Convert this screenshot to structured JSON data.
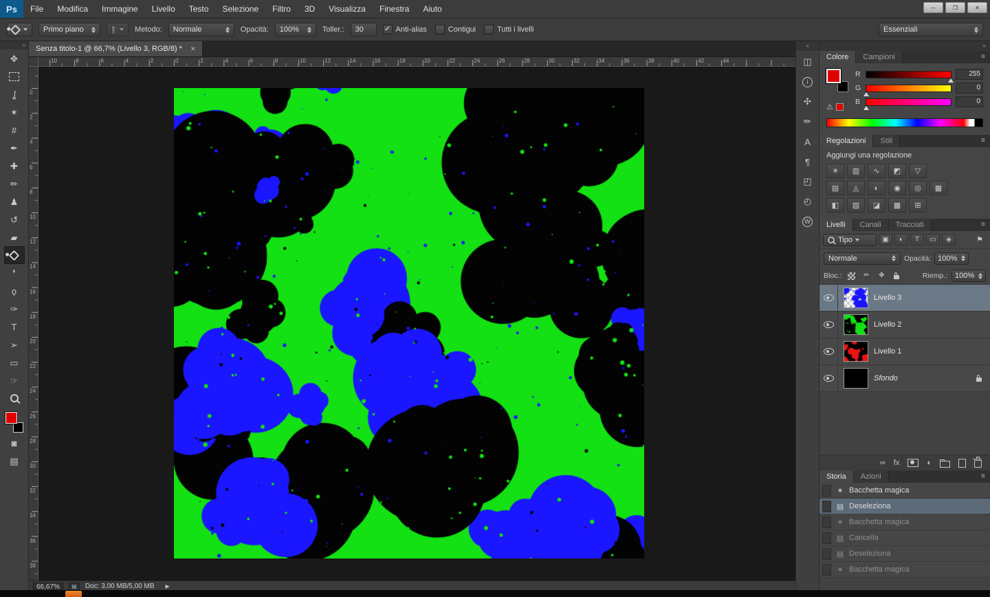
{
  "menubar": {
    "logo": "Ps",
    "items": [
      "File",
      "Modifica",
      "Immagine",
      "Livello",
      "Testo",
      "Selezione",
      "Filtro",
      "3D",
      "Visualizza",
      "Finestra",
      "Aiuto"
    ]
  },
  "window_controls": {
    "minimize": "─",
    "restore": "❐",
    "close": "✕"
  },
  "icons": {
    "collapse_right": "»",
    "collapse_left": "«",
    "panel_menu": "≡",
    "status_doc": "▤"
  },
  "options_bar": {
    "fill_source": "Primo piano",
    "method_label": "Metodo:",
    "method_value": "Normale",
    "opacity_label": "Opacità:",
    "opacity_value": "100%",
    "tolerance_label": "Toller.:",
    "tolerance_value": "30",
    "checkboxes": [
      {
        "label": "Anti-alias",
        "checked": true
      },
      {
        "label": "Contigui",
        "checked": false
      },
      {
        "label": "Tutti i livelli",
        "checked": false
      }
    ],
    "workspace": "Essenziali"
  },
  "toolbar": {
    "tools": [
      {
        "name": "move-tool",
        "glyph": "✥"
      },
      {
        "name": "rectangular-marquee-tool",
        "css": "marquee"
      },
      {
        "name": "lasso-tool",
        "glyph": "ʆ"
      },
      {
        "name": "magic-wand-tool",
        "glyph": "✶"
      },
      {
        "name": "crop-tool",
        "glyph": "#"
      },
      {
        "name": "eyedropper-tool",
        "glyph": "✒"
      },
      {
        "name": "healing-brush-tool",
        "glyph": "✚"
      },
      {
        "name": "brush-tool",
        "glyph": "✏"
      },
      {
        "name": "clone-stamp-tool",
        "glyph": "♟"
      },
      {
        "name": "history-brush-tool",
        "glyph": "↺"
      },
      {
        "name": "eraser-tool",
        "glyph": "▰"
      },
      {
        "name": "paint-bucket-tool",
        "css": "bucket",
        "selected": true
      },
      {
        "name": "blur-tool",
        "glyph": "❜"
      },
      {
        "name": "dodge-tool",
        "glyph": "ϙ"
      },
      {
        "name": "pen-tool",
        "glyph": "✑"
      },
      {
        "name": "type-tool",
        "glyph": "T"
      },
      {
        "name": "path-selection-tool",
        "glyph": "➢"
      },
      {
        "name": "rectangle-tool",
        "glyph": "▭"
      },
      {
        "name": "hand-tool",
        "glyph": "☞"
      },
      {
        "name": "zoom-tool",
        "css": "mag"
      }
    ],
    "extras": [
      {
        "name": "quick-mask-mode-button",
        "glyph": "◙"
      },
      {
        "name": "screen-mode-button",
        "glyph": "▤"
      }
    ]
  },
  "document": {
    "tab_title": "Senza titolo-1 @ 66,7% (Livello 3, RGB/8) *",
    "close_icon": "✕"
  },
  "rulers": {
    "h_labels": [
      "10",
      "8",
      "6",
      "4",
      "2",
      "0",
      "2",
      "4",
      "6",
      "8",
      "10",
      "12",
      "14",
      "16",
      "18",
      "20",
      "22",
      "24",
      "26",
      "28",
      "30",
      "32",
      "34",
      "36",
      "38",
      "40",
      "42",
      "44"
    ],
    "v_labels": [
      "0",
      "2",
      "4",
      "6",
      "8",
      "10",
      "12",
      "14",
      "16",
      "18",
      "20",
      "22",
      "24",
      "26",
      "28",
      "30",
      "32",
      "34",
      "36",
      "38"
    ]
  },
  "canvas_colors": {
    "background": "#13e113",
    "blue": "#1a16ff",
    "black": "#030303",
    "red": "#e81515"
  },
  "status_bar": {
    "zoom": "66,67%",
    "doc": "Doc: 3,00 MB/5,00 MB",
    "arrow": "▶"
  },
  "panel_icons": [
    {
      "name": "histogram-panel-icon",
      "glyph": "◫"
    },
    {
      "name": "info-panel-icon",
      "circ": "i"
    },
    {
      "name": "tool-presets-panel-icon",
      "glyph": "✣"
    },
    {
      "name": "brush-presets-panel-icon",
      "glyph": "✏"
    },
    {
      "name": "character-panel-icon",
      "glyph": "A"
    },
    {
      "name": "paragraph-panel-icon",
      "glyph": "¶"
    },
    {
      "name": "layer-comps-panel-icon",
      "glyph": "◰"
    },
    {
      "name": "timeline-panel-icon",
      "glyph": "◴"
    },
    {
      "name": "wacom-panel-icon",
      "circ": "W"
    }
  ],
  "color": {
    "tabs": [
      "Colore",
      "Campioni"
    ],
    "warning": "⚠",
    "channels": [
      {
        "label": "R",
        "value": "255",
        "grad": [
          "#000000",
          "#ff0000"
        ]
      },
      {
        "label": "G",
        "value": "0",
        "grad": [
          "#ff0000",
          "#ffff00"
        ]
      },
      {
        "label": "B",
        "value": "0",
        "grad": [
          "#ff0000",
          "#ff00ff"
        ]
      }
    ]
  },
  "adjustments": {
    "tabs": [
      "Regolazioni",
      "Stili"
    ],
    "title": "Aggiungi una regolazione",
    "rows": [
      [
        {
          "name": "brightness-contrast-icon",
          "glyph": "☀"
        },
        {
          "name": "levels-icon",
          "glyph": "▥"
        },
        {
          "name": "curves-icon",
          "glyph": "∿"
        },
        {
          "name": "exposure-icon",
          "glyph": "◩"
        },
        {
          "name": "vibrance-icon",
          "glyph": "▽"
        }
      ],
      [
        {
          "name": "hue-saturation-icon",
          "glyph": "▤"
        },
        {
          "name": "color-balance-icon",
          "glyph": "◬"
        },
        {
          "name": "black-white-icon",
          "glyph": "◐"
        },
        {
          "name": "photo-filter-icon",
          "glyph": "◉"
        },
        {
          "name": "channel-mixer-icon",
          "glyph": "◎"
        },
        {
          "name": "color-lookup-icon",
          "glyph": "▦"
        }
      ],
      [
        {
          "name": "invert-icon",
          "glyph": "◧"
        },
        {
          "name": "posterize-icon",
          "glyph": "▨"
        },
        {
          "name": "threshold-icon",
          "glyph": "◪"
        },
        {
          "name": "gradient-map-icon",
          "glyph": "▩"
        },
        {
          "name": "selective-color-icon",
          "glyph": "⊞"
        }
      ]
    ]
  },
  "layers": {
    "tabs": [
      "Livelli",
      "Canali",
      "Tracciati"
    ],
    "filter_label": "Tipo",
    "filter_icons": [
      {
        "name": "filter-pixel-layers-icon",
        "glyph": "▣"
      },
      {
        "name": "filter-adjustment-layers-icon",
        "glyph": "◐"
      },
      {
        "name": "filter-type-layers-icon",
        "glyph": "T"
      },
      {
        "name": "filter-shape-layers-icon",
        "glyph": "▭"
      },
      {
        "name": "filter-smart-objects-icon",
        "glyph": "◈"
      }
    ],
    "flag": "⚑",
    "blend_mode": "Normale",
    "opacity_label": "Opacità:",
    "opacity": "100%",
    "lock_label": "Bloc.:",
    "lock_icons": [
      {
        "name": "lock-transparent-pixels-icon",
        "css": "i-checker"
      },
      {
        "name": "lock-image-pixels-icon",
        "glyph": "✏"
      },
      {
        "name": "lock-position-icon",
        "glyph": "✥"
      },
      {
        "name": "lock-all-icon",
        "css": "i-lock"
      }
    ],
    "fill_label": "Riemp.:",
    "fill": "100%",
    "items": [
      {
        "name": "Livello 3",
        "thumb": "blue-on-checker",
        "selected": true
      },
      {
        "name": "Livello 2",
        "thumb": "green-on-black"
      },
      {
        "name": "Livello 1",
        "thumb": "red-on-black"
      },
      {
        "name": "Sfondo",
        "thumb": "black",
        "italic": true,
        "locked": true
      }
    ],
    "bottom_icons": [
      {
        "name": "link-layers-icon",
        "glyph": "∞"
      },
      {
        "name": "layer-effects-icon",
        "glyph": "fx"
      },
      {
        "name": "add-layer-mask-icon",
        "css": "i-mask"
      },
      {
        "name": "new-adjustment-layer-icon",
        "glyph": "◐"
      },
      {
        "name": "new-group-icon",
        "css": "i-folder"
      },
      {
        "name": "new-layer-icon",
        "css": "i-page"
      },
      {
        "name": "delete-layer-icon",
        "css": "i-trash"
      }
    ]
  },
  "history": {
    "tabs": [
      "Storia",
      "Azioni"
    ],
    "items": [
      {
        "label": "Bacchetta magica",
        "icon": "wand"
      },
      {
        "label": "Deseleziona",
        "icon": "doc",
        "selected": true
      },
      {
        "label": "Bacchetta magica",
        "icon": "wand",
        "dim": true
      },
      {
        "label": "Cancella",
        "icon": "doc",
        "dim": true
      },
      {
        "label": "Deseleziona",
        "icon": "doc",
        "dim": true
      },
      {
        "label": "Bacchetta magica",
        "icon": "wand",
        "dim": true
      }
    ]
  },
  "taskbar": {
    "app_color": "#e8731e"
  }
}
